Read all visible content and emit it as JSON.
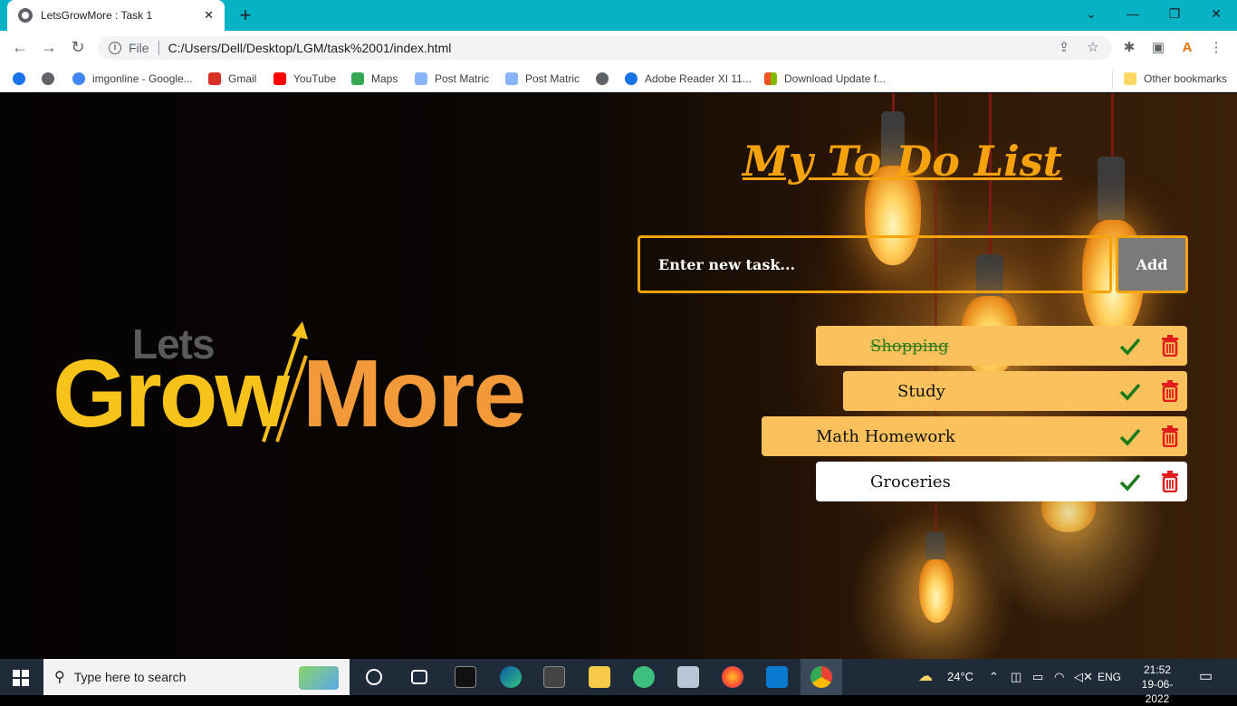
{
  "browser": {
    "tab_title": "LetsGrowMore : Task 1",
    "tab_close": "✕",
    "new_tab": "+",
    "url_scheme_label": "File",
    "url": "C:/Users/Dell/Desktop/LGM/task%2001/index.html",
    "window_controls": [
      "⌄",
      "—",
      "❐",
      "✕"
    ],
    "bookmarks": [
      {
        "label": "imgonline - Google...",
        "icon": "google-icon",
        "color": "#4285f4"
      },
      {
        "label": "Gmail",
        "icon": "gmail-icon",
        "color": "#d93025"
      },
      {
        "label": "YouTube",
        "icon": "youtube-icon",
        "color": "#ff0000"
      },
      {
        "label": "Maps",
        "icon": "maps-icon",
        "color": "#34a853"
      },
      {
        "label": "Post Matric",
        "icon": "post-matric-icon",
        "color": "#8ab4f8"
      },
      {
        "label": "Post Matric",
        "icon": "post-matric-icon",
        "color": "#8ab4f8"
      },
      {
        "label": "Adobe Reader XI 11...",
        "icon": "adobe-icon",
        "color": "#1a73e8"
      },
      {
        "label": "Download Update f...",
        "icon": "windows-icon",
        "color": "#f25022"
      }
    ],
    "other_bookmarks": "Other bookmarks"
  },
  "page": {
    "logo": {
      "lets": "Lets",
      "grow": "Grow",
      "more": "More"
    },
    "heading": "My To Do List",
    "input_placeholder": "Enter new task...",
    "add_label": "Add",
    "accent_color": "#f5a20c",
    "tasks": [
      {
        "label": "Shopping",
        "done": true
      },
      {
        "label": "Study",
        "done": false
      },
      {
        "label": "Math Homework",
        "done": false
      },
      {
        "label": "Groceries",
        "done": false
      }
    ]
  },
  "taskbar": {
    "search_placeholder": "Type here to search",
    "weather": "24°C",
    "language": "ENG",
    "time": "21:52",
    "date": "19-06-2022"
  }
}
